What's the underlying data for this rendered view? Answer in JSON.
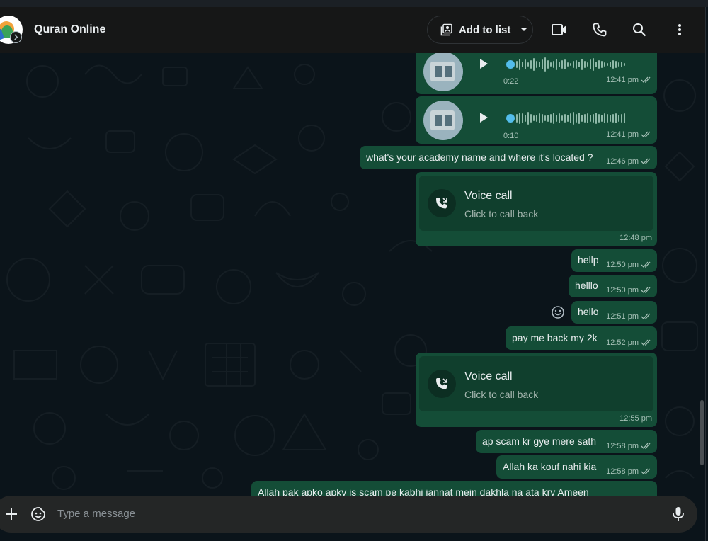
{
  "header": {
    "title": "Quran Online",
    "add_to_list": "Add to list"
  },
  "messages": {
    "voice1": {
      "duration": "0:22",
      "time": "12:41 pm"
    },
    "voice2": {
      "duration": "0:10",
      "time": "12:41 pm"
    },
    "m1": {
      "text": "what's your academy name and where it's located ?",
      "time": "12:46 pm"
    },
    "call1": {
      "title": "Voice call",
      "subtitle": "Click to call back",
      "time": "12:48 pm"
    },
    "m2": {
      "text": "hellp",
      "time": "12:50 pm"
    },
    "m3": {
      "text": "helllo",
      "time": "12:50 pm"
    },
    "m4": {
      "text": "hello",
      "time": "12:51 pm"
    },
    "m5": {
      "text": "pay me back my 2k",
      "time": "12:52 pm"
    },
    "call2": {
      "title": "Voice call",
      "subtitle": "Click to call back",
      "time": "12:55 pm"
    },
    "m6": {
      "text": "ap scam kr gye mere sath",
      "time": "12:58 pm"
    },
    "m7": {
      "text": "Allah ka kouf nahi kia",
      "time": "12:58 pm"
    },
    "m8": {
      "text": "Allah pak apko apky is scam pe kabhi jannat mein dakhla na ata kry Ameen"
    }
  },
  "composer": {
    "placeholder": "Type a message"
  },
  "colors": {
    "outgoing_bubble": "#144d37",
    "background": "#0b141a",
    "header": "#161717",
    "read_tick": "#a6c1b7"
  },
  "icons": [
    "video-call-icon",
    "phone-icon",
    "search-icon",
    "menu-icon",
    "plus-icon",
    "sticker-icon",
    "mic-icon",
    "play-icon",
    "missed-call-icon",
    "emoji-react-icon"
  ]
}
